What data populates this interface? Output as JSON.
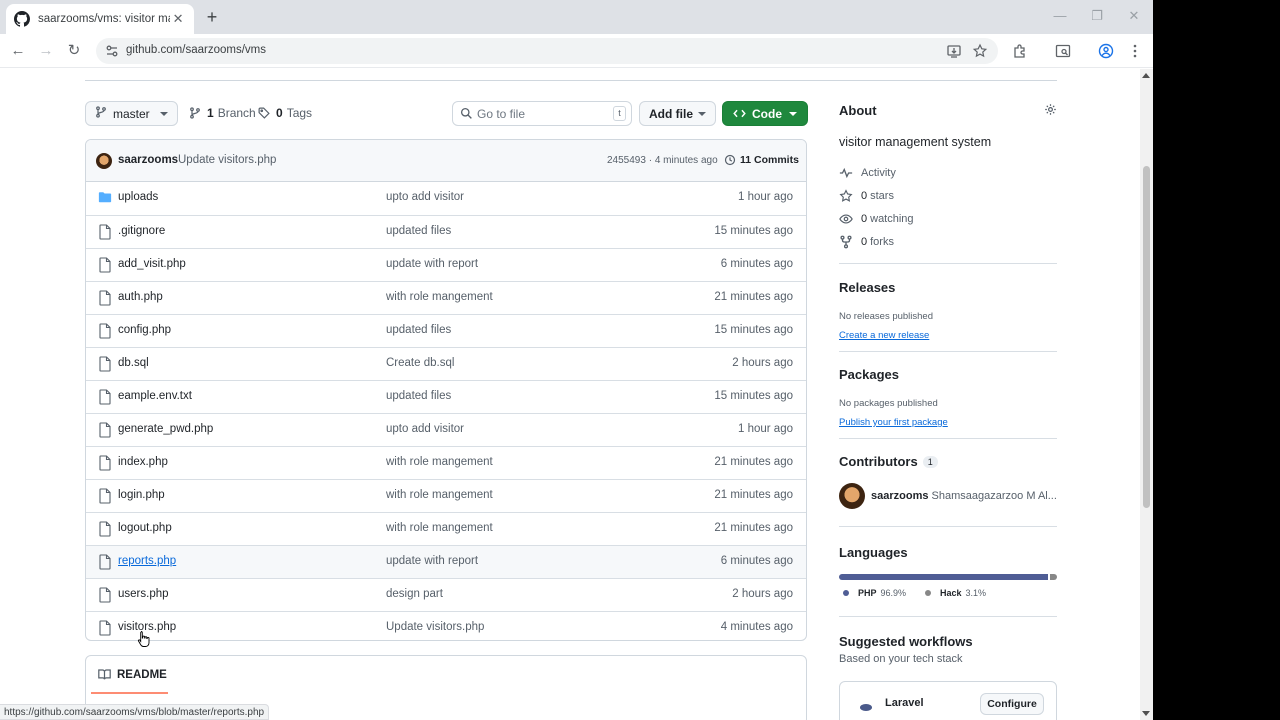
{
  "browser": {
    "tab_title": "saarzooms/vms: visitor manage",
    "url": "github.com/saarzooms/vms",
    "status_url": "https://github.com/saarzooms/vms/blob/master/reports.php",
    "icons": [
      "github-icon",
      "close-icon",
      "plus-icon",
      "back-icon",
      "forward-icon",
      "reload-icon",
      "site-info-icon",
      "install-icon",
      "star-icon",
      "extensions-icon",
      "tab-search-icon",
      "profile-icon",
      "menu-icon"
    ]
  },
  "repo": {
    "branch": "master",
    "branches_count": "1",
    "branches_label": "Branch",
    "tags_count": "0",
    "tags_label": "Tags",
    "search_placeholder": "Go to file",
    "search_shortcut": "t",
    "add_file_label": "Add file",
    "code_label": "Code"
  },
  "latest_commit": {
    "author": "saarzooms",
    "message": "Update visitors.php",
    "hash_time": "2455493 · 4 minutes ago",
    "commits_count": "11 Commits"
  },
  "files": [
    {
      "name": "uploads",
      "type": "folder",
      "message": "upto add visitor",
      "time": "1 hour ago"
    },
    {
      "name": ".gitignore",
      "type": "file",
      "message": "updated files",
      "time": "15 minutes ago"
    },
    {
      "name": "add_visit.php",
      "type": "file",
      "message": "update with report",
      "time": "6 minutes ago"
    },
    {
      "name": "auth.php",
      "type": "file",
      "message": "with role mangement",
      "time": "21 minutes ago"
    },
    {
      "name": "config.php",
      "type": "file",
      "message": "updated files",
      "time": "15 minutes ago"
    },
    {
      "name": "db.sql",
      "type": "file",
      "message": "Create db.sql",
      "time": "2 hours ago"
    },
    {
      "name": "eample.env.txt",
      "type": "file",
      "message": "updated files",
      "time": "15 minutes ago"
    },
    {
      "name": "generate_pwd.php",
      "type": "file",
      "message": "upto add visitor",
      "time": "1 hour ago"
    },
    {
      "name": "index.php",
      "type": "file",
      "message": "with role mangement",
      "time": "21 minutes ago"
    },
    {
      "name": "login.php",
      "type": "file",
      "message": "with role mangement",
      "time": "21 minutes ago"
    },
    {
      "name": "logout.php",
      "type": "file",
      "message": "with role mangement",
      "time": "21 minutes ago"
    },
    {
      "name": "reports.php",
      "type": "file",
      "message": "update with report",
      "time": "6 minutes ago",
      "hovered": true
    },
    {
      "name": "users.php",
      "type": "file",
      "message": "design part",
      "time": "2 hours ago"
    },
    {
      "name": "visitors.php",
      "type": "file",
      "message": "Update visitors.php",
      "time": "4 minutes ago"
    }
  ],
  "readme_label": "README",
  "about": {
    "heading": "About",
    "description": "visitor management system",
    "activity": "Activity",
    "stars_count": "0",
    "stars_label": "stars",
    "watching_count": "0",
    "watching_label": "watching",
    "forks_count": "0",
    "forks_label": "forks"
  },
  "releases": {
    "heading": "Releases",
    "note": "No releases published",
    "link": "Create a new release"
  },
  "packages": {
    "heading": "Packages",
    "note": "No packages published",
    "link": "Publish your first package"
  },
  "contributors": {
    "heading": "Contributors",
    "count": "1",
    "user": "saarzooms",
    "full_name": "Shamsaagazarzoo M Al..."
  },
  "languages": {
    "heading": "Languages",
    "items": [
      {
        "name": "PHP",
        "percent": "96.9%",
        "value": 96.9,
        "color": "#4f5d95"
      },
      {
        "name": "Hack",
        "percent": "3.1%",
        "value": 3.1,
        "color": "#878787"
      }
    ]
  },
  "workflows": {
    "heading": "Suggested workflows",
    "subheading": "Based on your tech stack",
    "name": "Laravel",
    "button": "Configure"
  },
  "colors": {
    "primary_button": "#1f883d",
    "link": "#0969da",
    "readme_underline": "#fd8c73"
  }
}
